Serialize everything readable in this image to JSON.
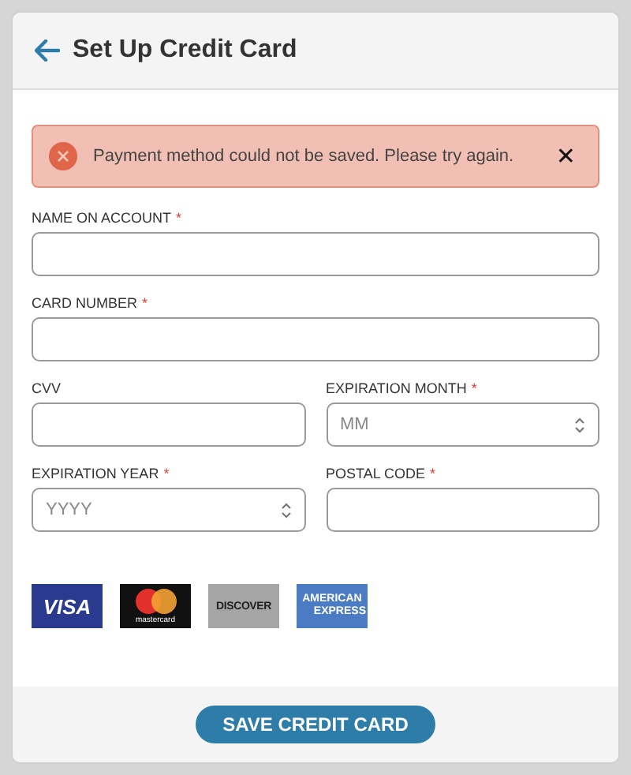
{
  "header": {
    "title": "Set Up Credit Card"
  },
  "alert": {
    "message": "Payment method could not be saved. Please try again.",
    "close": "✕"
  },
  "fields": [
    {
      "label": "NAME ON ACCOUNT",
      "required_mark": "*",
      "kind": "text",
      "wide": true
    },
    {
      "label": "CARD NUMBER",
      "required_mark": "*",
      "kind": "text",
      "wide": true
    },
    {
      "label": "CVV",
      "kind": "text",
      "wide": false
    },
    {
      "label": "EXPIRATION MONTH",
      "required_mark": "*",
      "kind": "select",
      "placeholder": "MM",
      "wide": false
    },
    {
      "label": "EXPIRATION YEAR",
      "required_mark": "*",
      "kind": "select",
      "placeholder": "YYYY",
      "wide": false
    },
    {
      "label": "POSTAL CODE",
      "required_mark": "*",
      "kind": "text",
      "wide": false
    }
  ],
  "card_logos": [
    {
      "kind": "visa",
      "text": "VISA"
    },
    {
      "kind": "mastercard",
      "text": "mastercard"
    },
    {
      "kind": "discover",
      "text": "DISCOVER"
    },
    {
      "kind": "amex",
      "text": "AMERICAN",
      "text2": "EXPRESS"
    }
  ],
  "save_button": "SAVE CREDIT CARD"
}
